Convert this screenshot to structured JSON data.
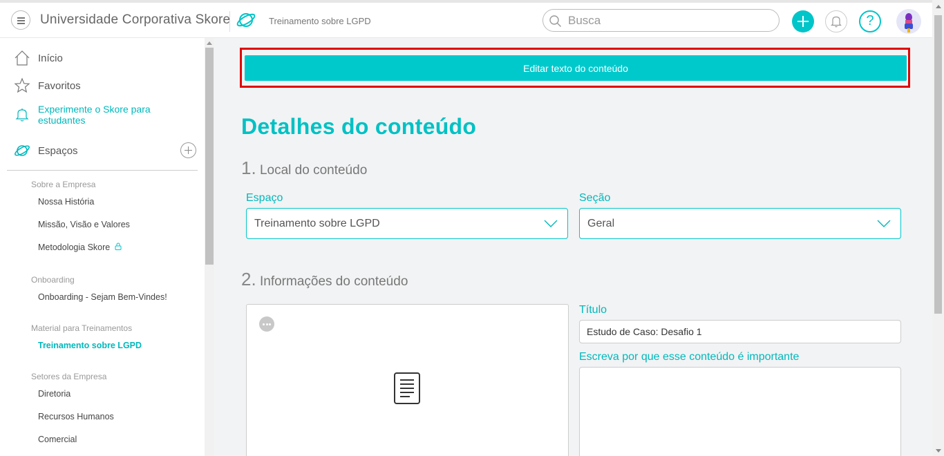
{
  "header": {
    "app_title": "Universidade Corporativa Skore",
    "breadcrumb": "Treinamento sobre LGPD",
    "search_placeholder": "Busca",
    "help_label": "?"
  },
  "sidebar": {
    "nav": [
      {
        "label": "Início",
        "icon": "home-icon"
      },
      {
        "label": "Favoritos",
        "icon": "star-icon"
      },
      {
        "label": "Experimente o Skore para estudantes",
        "icon": "bell-icon"
      }
    ],
    "spaces_label": "Espaços",
    "groups": [
      {
        "title": "Sobre a Empresa",
        "items": [
          "Nossa História",
          "Missão, Visão e Valores",
          "Metodologia Skore"
        ]
      },
      {
        "title": "Onboarding",
        "items": [
          "Onboarding - Sejam Bem-Vindes!"
        ]
      },
      {
        "title": "Material para Treinamentos",
        "items": [
          "Treinamento sobre LGPD"
        ]
      },
      {
        "title": "Setores da Empresa",
        "items": [
          "Diretoria",
          "Recursos Humanos",
          "Comercial"
        ]
      }
    ],
    "active_item": "Treinamento sobre LGPD"
  },
  "main": {
    "edit_button": "Editar texto do conteúdo",
    "page_title": "Detalhes do conteúdo",
    "section1": {
      "num": "1.",
      "title": "Local do conteúdo"
    },
    "space_label": "Espaço",
    "space_value": "Treinamento sobre LGPD",
    "section_label": "Seção",
    "section_value": "Geral",
    "section2": {
      "num": "2.",
      "title": "Informações do conteúdo"
    },
    "title_label": "Título",
    "title_value": "Estudo de Caso: Desafio 1",
    "why_label": "Escreva por que esse conteúdo é importante",
    "why_value": ""
  },
  "colors": {
    "accent": "#00c5c9",
    "highlight_border": "#e00000",
    "background": "#f2f3f4"
  }
}
